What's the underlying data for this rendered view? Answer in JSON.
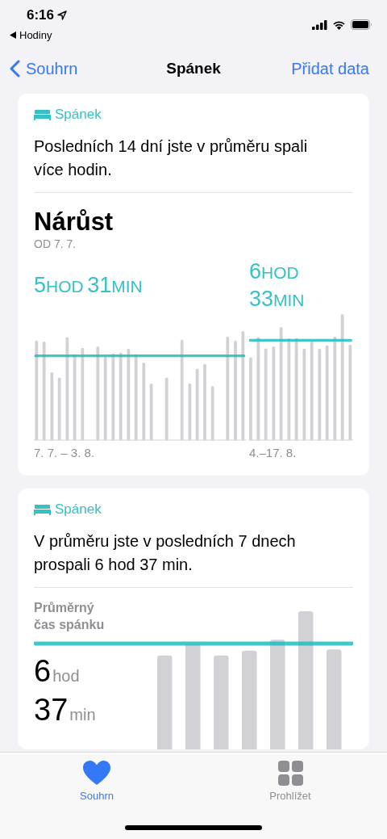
{
  "status_bar": {
    "time": "6:16",
    "back_app": "Hodiny"
  },
  "nav": {
    "back": "Souhrn",
    "title": "Spánek",
    "action": "Přidat data"
  },
  "cards": [
    {
      "kind": "trend",
      "category": "Spánek",
      "summary": "Posledních 14 dní jste v průměru spali více hodin.",
      "heading": "Nárůst",
      "subheading": "OD 7. 7.",
      "periods": [
        {
          "average": [
            {
              "value": "5",
              "unit": "HOD"
            },
            {
              "value": "31",
              "unit": "MIN"
            }
          ],
          "range": "7. 7. – 3. 8."
        },
        {
          "average": [
            {
              "value": "6",
              "unit": "HOD"
            },
            {
              "value": "33",
              "unit": "MIN"
            }
          ],
          "range": "4.–17. 8."
        }
      ]
    },
    {
      "kind": "average",
      "category": "Spánek",
      "summary": "V průměru jste v posledních 7 dnech prospali 6 hod 37 min.",
      "label": "Průměrný čas spánku",
      "value": [
        {
          "value": "6",
          "unit": "hod"
        },
        {
          "value": "37",
          "unit": "min"
        }
      ]
    }
  ],
  "tab_bar": [
    {
      "kind": "heart",
      "label": "Souhrn",
      "selected": true
    },
    {
      "kind": "grid",
      "label": "Prohlížet",
      "selected": false
    }
  ]
}
